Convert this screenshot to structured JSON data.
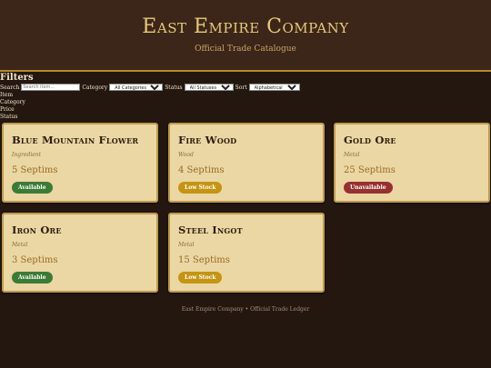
{
  "header": {
    "title": "East Empire Company",
    "subtitle": "Official Trade Catalogue"
  },
  "filters": {
    "title": "Filters",
    "search_label": "Search",
    "search_placeholder": "Search item...",
    "category_label": "Category",
    "category_value": "All Categories",
    "status_label": "Status",
    "status_value": "All Statuses",
    "sort_label": "Sort",
    "sort_value": "Alphabetical",
    "sort_options": [
      "Item",
      "Category",
      "Price",
      "Status"
    ]
  },
  "items": [
    {
      "name": "Blue Mountain Flower",
      "category": "Ingredient",
      "price": "5 Septims",
      "status": "Available",
      "status_type": "available"
    },
    {
      "name": "Fire Wood",
      "category": "Wood",
      "price": "4 Septims",
      "status": "Low Stock",
      "status_type": "low"
    },
    {
      "name": "Gold Ore",
      "category": "Metal",
      "price": "25 Septims",
      "status": "Unavailable",
      "status_type": "unavailable"
    },
    {
      "name": "Iron Ore",
      "category": "Metal",
      "price": "3 Septims",
      "status": "Available",
      "status_type": "available"
    },
    {
      "name": "Steel Ingot",
      "category": "Metal",
      "price": "15 Septims",
      "status": "Low Stock",
      "status_type": "low"
    }
  ],
  "footer": {
    "text": "East Empire Company • Official Trade Ledger"
  },
  "colors": {
    "background": "#231710",
    "header": "#3b2619",
    "accent": "#e8c878",
    "card": "#ead7a3",
    "available": "#3c7b35",
    "low_stock": "#c59412",
    "unavailable": "#983030"
  }
}
